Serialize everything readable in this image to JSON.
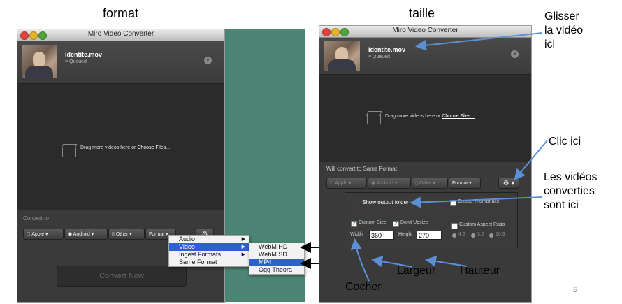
{
  "captions": {
    "left": "format",
    "right": "taille"
  },
  "app": {
    "title": "Miro Video Converter"
  },
  "file": {
    "name": "identite.mov",
    "status": "≡ Queued"
  },
  "drop": {
    "text": "Drag more videos here or ",
    "link": "Choose Files..."
  },
  "left_window": {
    "convert_label": "Convert to",
    "buttons": [
      {
        "label": "Apple ▾",
        "icon": "apple-icon"
      },
      {
        "label": "Android ▾",
        "icon": "android-icon"
      },
      {
        "label": "Other ▾",
        "icon": "phone-icon"
      },
      {
        "label": "Format ▾",
        "icon": ""
      }
    ],
    "convert_now": "Convert Now"
  },
  "menus": {
    "primary": [
      {
        "label": "Audio",
        "arrow": "▶"
      },
      {
        "label": "Video",
        "arrow": "▶",
        "selected": true
      },
      {
        "label": "Ingest Formats",
        "arrow": "▶"
      },
      {
        "label": "Same Format",
        "arrow": ""
      }
    ],
    "submenu": [
      {
        "label": "WebM HD"
      },
      {
        "label": "WebM SD"
      },
      {
        "label": "MP4",
        "selected": true
      },
      {
        "label": "Ogg Theora"
      }
    ]
  },
  "right_window": {
    "convert_label": "Will convert to Same Format",
    "buttons": [
      {
        "label": "Apple ▾",
        "icon": "apple-icon"
      },
      {
        "label": "Android ▾",
        "icon": "android-icon"
      },
      {
        "label": "Other ▾",
        "icon": "phone-icon"
      },
      {
        "label": "Format ▾",
        "icon": ""
      }
    ],
    "settings": {
      "show_output": "Show output folder",
      "create_thumbnails": "Create Thumbnails",
      "custom_size": "Custom Size",
      "dont_upsize": "Don't Upsize",
      "custom_aspect": "Custom Aspect Ratio",
      "width_label": "Width",
      "width_value": "360",
      "height_label": "Height",
      "height_value": "270",
      "ratios": [
        "4:3",
        "3:2",
        "16:9"
      ]
    }
  },
  "annotations": {
    "glisser": [
      "Glisser",
      "la vidéo",
      "ici"
    ],
    "clic": "Clic ici",
    "videos": [
      "Les vidéos",
      "converties",
      "sont ici"
    ],
    "cocher": "Cocher",
    "largeur": "Largeur",
    "hauteur": "Hauteur",
    "page_number": "8"
  },
  "colors": {
    "accent": "#2f5fd7",
    "arrow": "#5b8fd6",
    "green_bg": "#4d8574"
  }
}
